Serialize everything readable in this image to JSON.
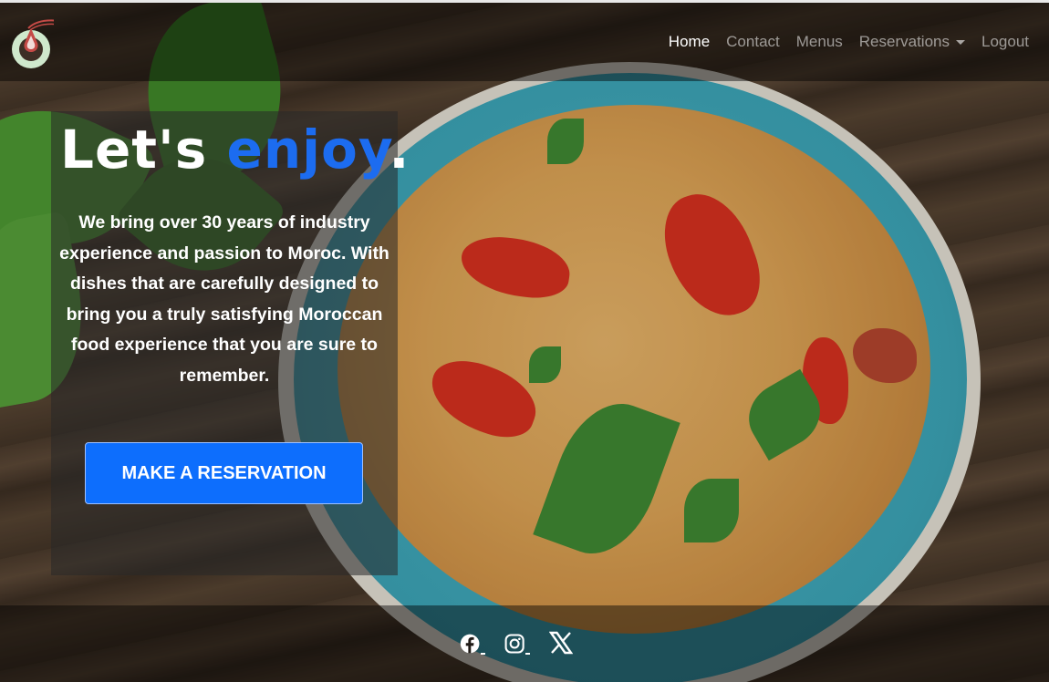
{
  "nav": {
    "logo_icon": "tagine-logo-icon",
    "links": [
      {
        "label": "Home",
        "active": true
      },
      {
        "label": "Contact",
        "active": false
      },
      {
        "label": "Menus",
        "active": false
      },
      {
        "label": "Reservations",
        "active": false,
        "dropdown": true
      },
      {
        "label": "Logout",
        "active": false
      }
    ]
  },
  "hero": {
    "title_start": "Let's ",
    "title_accent": "enjoy",
    "title_end": ".",
    "text": "We bring over 30 years of industry experience and passion to Moroc. With dishes that are carefully designed to bring you a truly satisfying Moroccan food experience that you are sure to remember.",
    "cta_label": "MAKE A RESERVATION"
  },
  "footer": {
    "social": [
      {
        "icon": "facebook-icon"
      },
      {
        "icon": "instagram-icon"
      },
      {
        "icon": "x-twitter-icon"
      }
    ]
  },
  "colors": {
    "accent": "#1c6cf0",
    "button": "#0d6efd",
    "nav_text": "#ffffff"
  }
}
